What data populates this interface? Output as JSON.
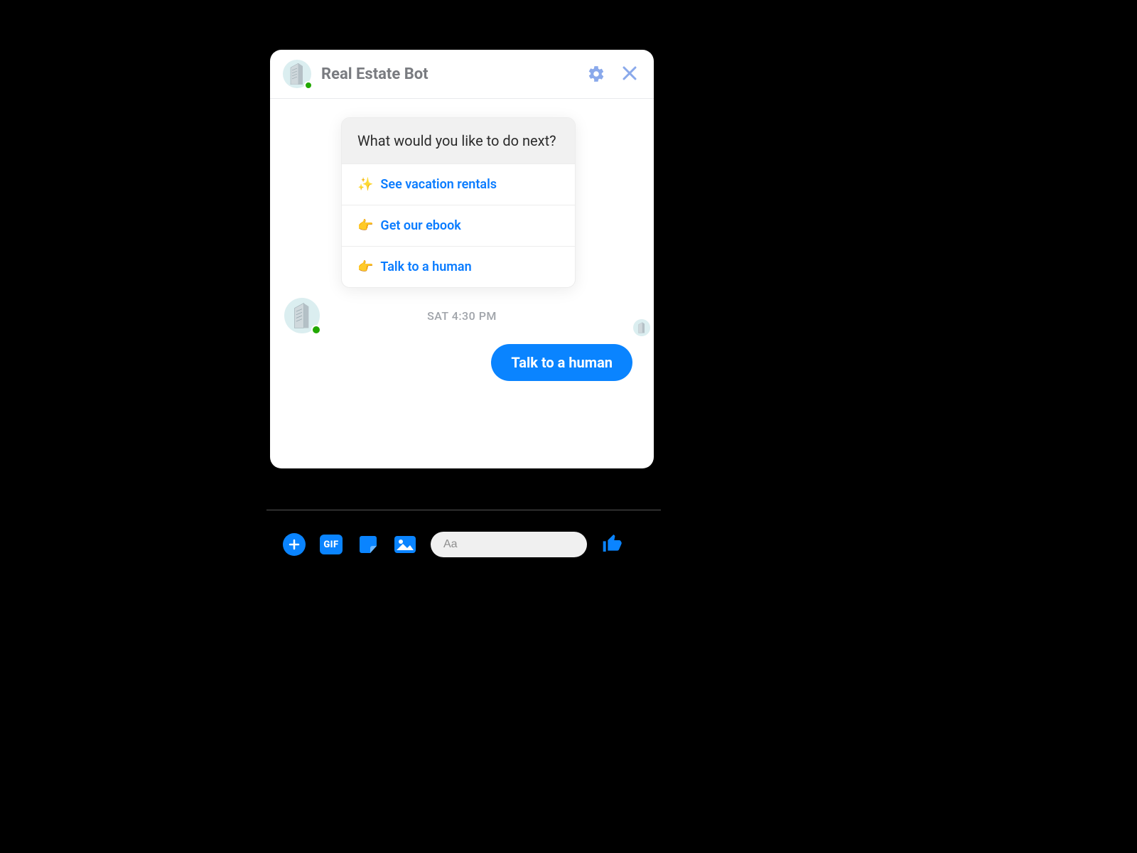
{
  "header": {
    "title": "Real Estate Bot"
  },
  "card": {
    "prompt": "What would you like to do next?",
    "options": [
      {
        "emoji": "✨",
        "label": "See vacation rentals"
      },
      {
        "emoji": "👉",
        "label": "Get our ebook"
      },
      {
        "emoji": "👉",
        "label": "Talk to a human"
      }
    ]
  },
  "timestamp": "SAT 4:30 PM",
  "userReply": "Talk to a human",
  "composer": {
    "placeholder": "Aa",
    "gifLabel": "GIF"
  }
}
